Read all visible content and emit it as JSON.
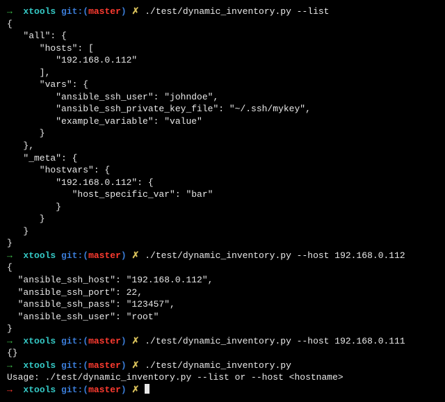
{
  "prompt": {
    "arrow": "→",
    "dir": "xtools",
    "git": "git:",
    "lparen": "(",
    "branch": "master",
    "rparen": ")",
    "x": "✗"
  },
  "block1": {
    "cmd": "./test/dynamic_inventory.py --list",
    "lines": [
      "{",
      "   \"all\": {",
      "      \"hosts\": [",
      "         \"192.168.0.112\"",
      "      ],",
      "      \"vars\": {",
      "         \"ansible_ssh_user\": \"johndoe\",",
      "         \"ansible_ssh_private_key_file\": \"~/.ssh/mykey\",",
      "         \"example_variable\": \"value\"",
      "      }",
      "   },",
      "   \"_meta\": {",
      "      \"hostvars\": {",
      "         \"192.168.0.112\": {",
      "            \"host_specific_var\": \"bar\"",
      "         }",
      "      }",
      "   }",
      "}"
    ]
  },
  "block2": {
    "cmd": "./test/dynamic_inventory.py --host 192.168.0.112",
    "lines": [
      "{",
      "  \"ansible_ssh_host\": \"192.168.0.112\",",
      "  \"ansible_ssh_port\": 22,",
      "  \"ansible_ssh_pass\": \"123457\",",
      "  \"ansible_ssh_user\": \"root\"",
      "}"
    ]
  },
  "block3": {
    "cmd": "./test/dynamic_inventory.py --host 192.168.0.111",
    "lines": [
      "{}"
    ]
  },
  "block4": {
    "cmd": "./test/dynamic_inventory.py",
    "lines": [
      "Usage: ./test/dynamic_inventory.py --list or --host <hostname>"
    ]
  }
}
